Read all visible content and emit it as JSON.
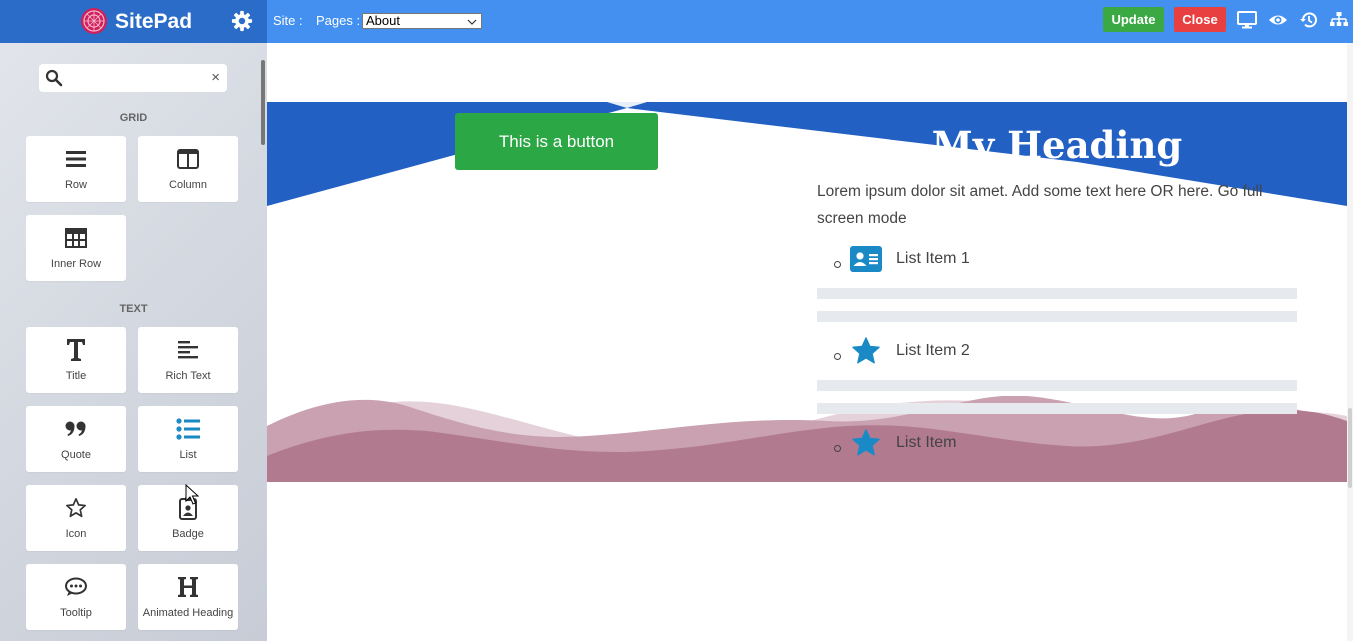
{
  "app": {
    "name": "SitePad"
  },
  "sidebar": {
    "search": {
      "value": "",
      "placeholder": "",
      "clear_glyph": "×"
    },
    "sections": [
      {
        "label": "GRID",
        "widgets": [
          {
            "label": "Row",
            "icon": "bars-icon"
          },
          {
            "label": "Column",
            "icon": "columns-icon"
          },
          {
            "label": "Inner Row",
            "icon": "table-icon"
          }
        ]
      },
      {
        "label": "TEXT",
        "widgets": [
          {
            "label": "Title",
            "icon": "title-t-icon"
          },
          {
            "label": "Rich Text",
            "icon": "align-left-icon"
          },
          {
            "label": "Quote",
            "icon": "quote-icon"
          },
          {
            "label": "List",
            "icon": "list-icon"
          },
          {
            "label": "Icon",
            "icon": "star-outline-icon"
          },
          {
            "label": "Badge",
            "icon": "badge-icon"
          },
          {
            "label": "Tooltip",
            "icon": "comment-dots-icon"
          },
          {
            "label": "Animated Heading",
            "icon": "heading-h-icon"
          }
        ]
      }
    ],
    "collapse_glyph": "‹"
  },
  "topbar": {
    "site_label": "Site :",
    "pages_label": "Pages :",
    "pages_selected": "About",
    "update_label": "Update",
    "close_label": "Close",
    "icons": [
      "desktop-icon",
      "eye-icon",
      "history-icon",
      "sitemap-icon"
    ]
  },
  "content": {
    "button_label": "This is a button",
    "heading": "My Heading",
    "paragraph": "Lorem ipsum dolor sit amet. Add some text here OR here. Go full screen mode",
    "list_items": [
      {
        "label": "List Item 1",
        "icon": "id-card-icon"
      },
      {
        "label": "List Item 2",
        "icon": "star-icon"
      },
      {
        "label": "List Item",
        "icon": "star-icon"
      }
    ]
  },
  "colors": {
    "topbar": "#4390f0",
    "sidebar_header": "#2a6cc8",
    "hero_blue": "#2360c4",
    "update_green": "#3aa843",
    "close_red": "#e84040",
    "button_green": "#2ca745",
    "wave_dark": "#b17a8f",
    "wave_mid": "#c9a1b1",
    "wave_light": "#e4d1d9",
    "list_icon": "#1a8ac6"
  }
}
